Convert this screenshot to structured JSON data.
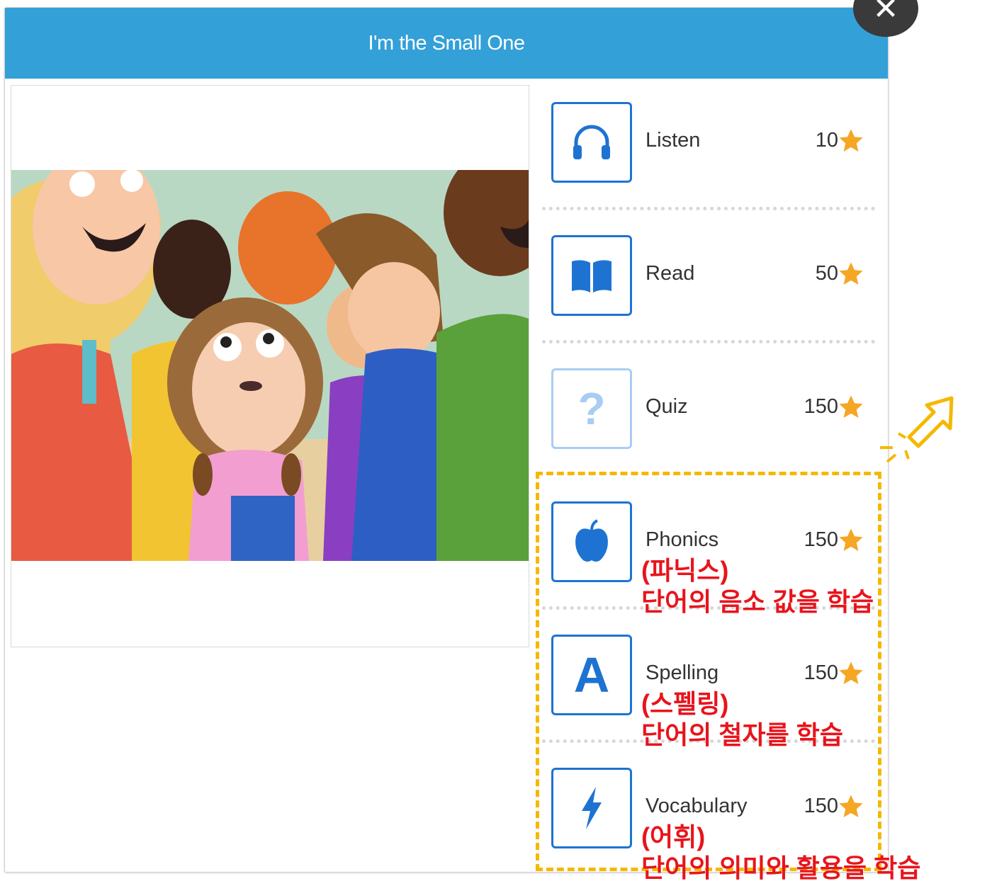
{
  "window": {
    "title": "I'm the Small One",
    "close_icon": "close-icon"
  },
  "activities": [
    {
      "id": "listen",
      "label": "Listen",
      "points": "10",
      "icon": "headphones-icon"
    },
    {
      "id": "read",
      "label": "Read",
      "points": "50",
      "icon": "book-icon"
    },
    {
      "id": "quiz",
      "label": "Quiz",
      "points": "150",
      "icon": "question-icon",
      "state": "faded"
    },
    {
      "id": "phonics",
      "label": "Phonics",
      "points": "150",
      "icon": "apple-icon"
    },
    {
      "id": "spelling",
      "label": "Spelling",
      "points": "150",
      "icon": "letter-a-icon"
    },
    {
      "id": "vocabulary",
      "label": "Vocabulary",
      "points": "150",
      "icon": "lightning-icon"
    }
  ],
  "annotations": {
    "phonics_line1": "(파닉스)",
    "phonics_line2": "단어의 음소 값을 학습",
    "spelling_line1": "(스펠링)",
    "spelling_line2": "단어의 철자를 학습",
    "vocabulary_line1": "(어휘)",
    "vocabulary_line2": "단어의 의미와 활용을 학습"
  },
  "colors": {
    "header": "#33a0d8",
    "icon_blue": "#1e73d2",
    "star": "#f5a623",
    "annotation": "#e8141c",
    "highlight": "#f5b800"
  }
}
